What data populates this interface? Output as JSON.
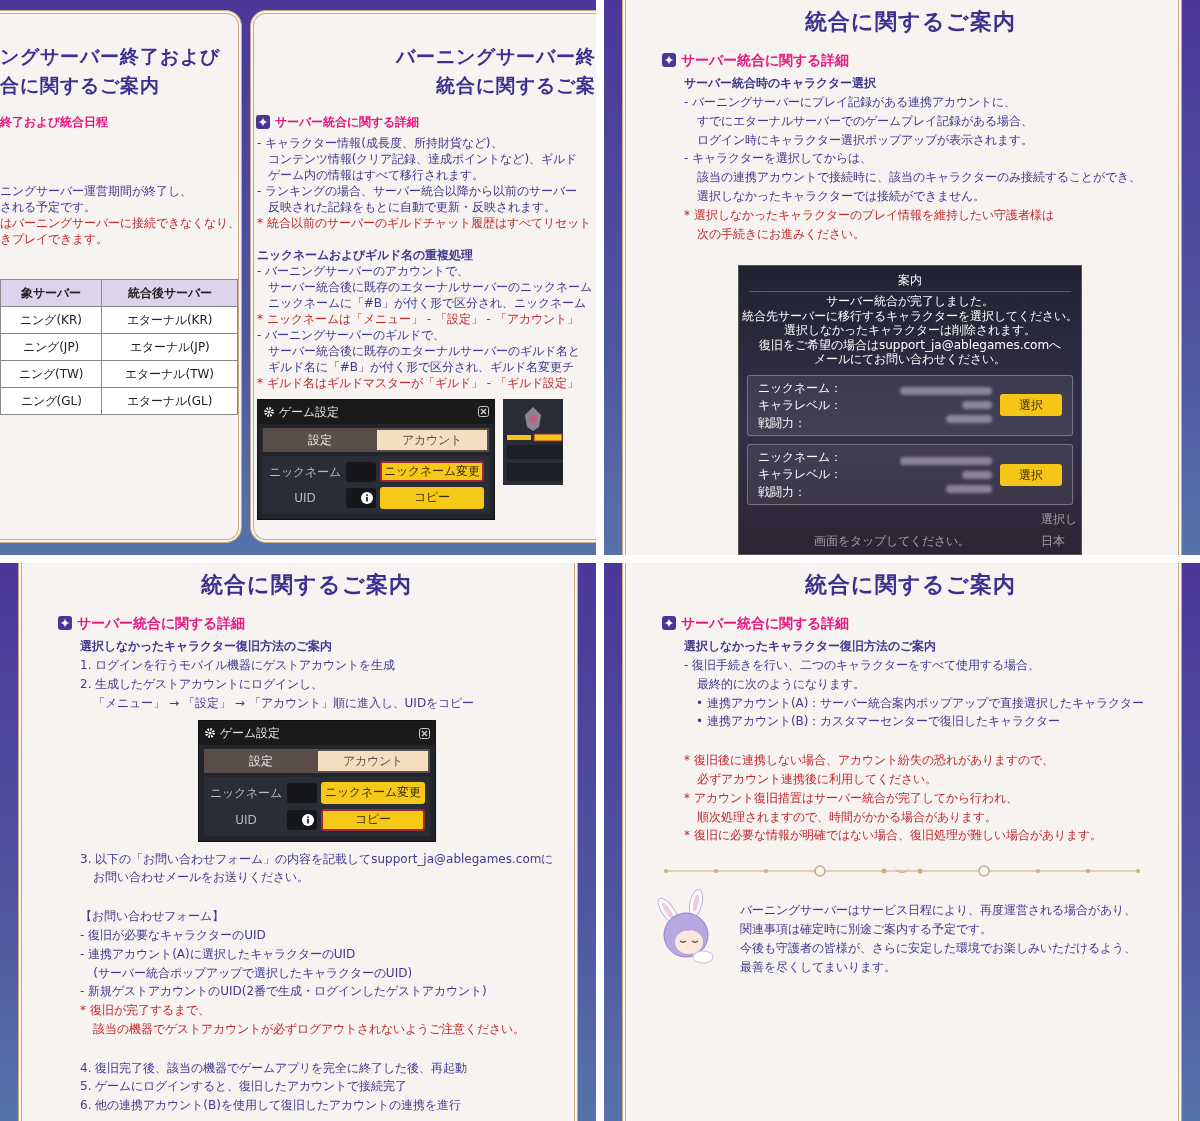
{
  "quadrants": [
    {
      "panels": [
        {
          "title_lines": [
            "ングサーバー終了および",
            "合に関するご案内"
          ],
          "heading_icon": false,
          "heading": "終了および統合日程",
          "blocks": [
            {
              "kind": "spacer"
            },
            {
              "kind": "spacer"
            },
            {
              "kind": "spacer"
            },
            {
              "kind": "text",
              "lines": [
                "ニングサーバー運営期間が終了し、",
                "される予定です。"
              ]
            },
            {
              "kind": "alert",
              "lines": [
                "はバーニングサーバーに接続できなくなり、",
                "きプレイできます。"
              ]
            },
            {
              "kind": "spacer"
            },
            {
              "kind": "spacer"
            },
            {
              "kind": "table",
              "columns": [
                "象サーバー",
                "統合後サーバー"
              ],
              "rows": [
                [
                  "ニング(KR)",
                  "エターナル(KR)"
                ],
                [
                  "ニング(JP)",
                  "エターナル(JP)"
                ],
                [
                  "ニング(TW)",
                  "エターナル(TW)"
                ],
                [
                  "ニング(GL)",
                  "エターナル(GL)"
                ]
              ]
            }
          ]
        },
        {
          "title_lines": [
            "バーニングサーバー終",
            "統合に関するご案"
          ],
          "heading_icon": true,
          "heading": "サーバー統合に関する詳細",
          "blocks": [
            {
              "kind": "item",
              "lines": [
                "- キャラクター情報(成長度、所持財貨など)、",
                "コンテンツ情報(クリア記録、達成ポイントなど)、ギルド",
                "ゲーム内の情報はすべて移行されます。"
              ]
            },
            {
              "kind": "item",
              "lines": [
                "- ランキングの場合、サーバー統合以降から以前のサーバー",
                "反映された記録をもとに自動で更新・反映されます。"
              ]
            },
            {
              "kind": "note",
              "lines": [
                "* 統合以前のサーバーのギルドチャット履歴はすべてリセット"
              ]
            },
            {
              "kind": "spacer"
            },
            {
              "kind": "subhead",
              "lines": [
                "ニックネームおよびギルド名の重複処理"
              ]
            },
            {
              "kind": "item",
              "lines": [
                "- バーニングサーバーのアカウントで、",
                "サーバー統合後に既存のエターナルサーバーのニックネーム",
                "ニックネームに「#B」が付く形で区分され、ニックネーム"
              ]
            },
            {
              "kind": "note",
              "lines": [
                "* ニックネームは「メニュー」 - 「設定」 - 「アカウント」"
              ]
            },
            {
              "kind": "item",
              "lines": [
                "- バーニングサーバーのギルドで、",
                "サーバー統合後に既存のエターナルサーバーのギルド名と",
                "ギルド名に「#B」が付く形で区分され、ギルド名変更チ"
              ]
            },
            {
              "kind": "note",
              "lines": [
                "* ギルド名はギルドマスターが「ギルド」 - 「ギルド設定」"
              ]
            },
            {
              "kind": "shots",
              "items": [
                {
                  "kind": "settings",
                  "title": "ゲーム設定",
                  "tabs": [
                    {
                      "label": "設定",
                      "selected": false
                    },
                    {
                      "label": "アカウント",
                      "selected": true
                    }
                  ],
                  "fields": [
                    {
                      "label": "ニックネーム",
                      "info": false,
                      "button": "ニックネーム変更",
                      "highlighted": true
                    },
                    {
                      "label": "UID",
                      "info": true,
                      "button": "コピー",
                      "highlighted": false
                    }
                  ]
                },
                {
                  "kind": "game_screen"
                }
              ]
            }
          ]
        }
      ]
    },
    {
      "panels": [
        {
          "title_lines": [
            "統合に関するご案内"
          ],
          "heading_icon": true,
          "heading": "サーバー統合に関する詳細",
          "blocks": [
            {
              "kind": "subhead",
              "lines": [
                "サーバー統合時のキャラクター選択"
              ]
            },
            {
              "kind": "item",
              "lines": [
                "- バーニングサーバーにプレイ記録がある連携アカウントに、",
                "すでにエターナルサーバーでのゲームプレイ記録がある場合、",
                "ログイン時にキャラクター選択ポップアップが表示されます。"
              ]
            },
            {
              "kind": "item",
              "lines": [
                "- キャラクターを選択してからは、",
                "該当の連携アカウントで接続時に、該当のキャラクターのみ接続することができ、",
                "選択しなかったキャラクターでは接続ができません。"
              ]
            },
            {
              "kind": "note",
              "lines": [
                "* 選択しなかったキャラクターのプレイ情報を維持したい守護者様は",
                "次の手続きにお進みください。"
              ]
            },
            {
              "kind": "dialog",
              "title": "案内",
              "message": [
                "サーバー統合が完了しました。",
                "統合先サーバーに移行するキャラクターを選択してください。",
                "選択しなかったキャラクターは削除されます。",
                "復旧をご希望の場合はsupport_ja@ablegames.comへ",
                "メールにてお問い合わせください。"
              ],
              "characters": [
                {
                  "labels": [
                    "ニックネーム：",
                    "キャラレベル：",
                    "戦闘力："
                  ],
                  "button": "選択"
                },
                {
                  "labels": [
                    "ニックネーム：",
                    "キャラレベル：",
                    "戦闘力："
                  ],
                  "button": "選択"
                }
              ],
              "hint": "画面をタップしてください。",
              "edge_labels": [
                "選択し",
                "日本"
              ]
            }
          ]
        }
      ]
    },
    {
      "panels": [
        {
          "title_lines": [
            "統合に関するご案内"
          ],
          "heading_icon": true,
          "heading": "サーバー統合に関する詳細",
          "blocks": [
            {
              "kind": "subhead",
              "lines": [
                "選択しなかったキャラクター復旧方法のご案内"
              ]
            },
            {
              "kind": "item",
              "lines": [
                "1. ログインを行うモバイル機器にゲストアカウントを生成"
              ]
            },
            {
              "kind": "item",
              "lines": [
                "2. 生成したゲストアカウントにログインし、",
                "「メニュー」 → 「設定」 → 「アカウント」順に進入し、UIDをコピー"
              ]
            },
            {
              "kind": "shots",
              "items": [
                {
                  "kind": "settings",
                  "title": "ゲーム設定",
                  "tabs": [
                    {
                      "label": "設定",
                      "selected": false
                    },
                    {
                      "label": "アカウント",
                      "selected": true
                    }
                  ],
                  "fields": [
                    {
                      "label": "ニックネーム",
                      "info": false,
                      "button": "ニックネーム変更",
                      "highlighted": false
                    },
                    {
                      "label": "UID",
                      "info": true,
                      "button": "コピー",
                      "highlighted": true
                    }
                  ]
                }
              ]
            },
            {
              "kind": "item",
              "lines": [
                "3. 以下の「お問い合わせフォーム」の内容を記載してsupport_ja@ablegames.comに",
                "お問い合わせメールをお送りください。"
              ]
            },
            {
              "kind": "spacer"
            },
            {
              "kind": "text",
              "lines": [
                "【お問い合わせフォーム】"
              ]
            },
            {
              "kind": "item",
              "lines": [
                "- 復旧が必要なキャラクターのUID"
              ]
            },
            {
              "kind": "item",
              "lines": [
                "- 連携アカウント(A)に選択したキャラクターのUID",
                "(サーバー統合ポップアップで選択したキャラクターのUID)"
              ]
            },
            {
              "kind": "item",
              "lines": [
                "- 新規ゲストアカウントのUID(2番で生成・ログインしたゲストアカウント)"
              ]
            },
            {
              "kind": "note",
              "lines": [
                "* 復旧が完了するまで、",
                "該当の機器でゲストアカウントが必ずログアウトされないようご注意ください。"
              ]
            },
            {
              "kind": "spacer"
            },
            {
              "kind": "item",
              "lines": [
                "4. 復旧完了後、該当の機器でゲームアプリを完全に終了した後、再起動"
              ]
            },
            {
              "kind": "item",
              "lines": [
                "5. ゲームにログインすると、復旧したアカウントで接続完了"
              ]
            },
            {
              "kind": "item",
              "lines": [
                "6. 他の連携アカウント(B)を使用して復旧したアカウントの連携を進行"
              ]
            }
          ]
        }
      ]
    },
    {
      "panels": [
        {
          "title_lines": [
            "統合に関するご案内"
          ],
          "heading_icon": true,
          "heading": "サーバー統合に関する詳細",
          "blocks": [
            {
              "kind": "subhead",
              "lines": [
                "選択しなかったキャラクター復旧方法のご案内"
              ]
            },
            {
              "kind": "item",
              "lines": [
                "- 復旧手続きを行い、二つのキャラクターをすべて使用する場合、",
                "最終的に次のようになります。"
              ]
            },
            {
              "kind": "bullet",
              "lines": [
                "• 連携アカウント(A)：サーバー統合案内ポップアップで直接選択したキャラクター"
              ]
            },
            {
              "kind": "bullet",
              "lines": [
                "• 連携アカウント(B)：カスタマーセンターで復旧したキャラクター"
              ]
            },
            {
              "kind": "spacer"
            },
            {
              "kind": "note",
              "lines": [
                "* 復旧後に連携しない場合、アカウント紛失の恐れがありますので、",
                "必ずアカウント連携後に利用してください。"
              ]
            },
            {
              "kind": "note",
              "lines": [
                "* アカウント復旧措置はサーバー統合が完了してから行われ、",
                "順次処理されますので、時間がかかる場合があります。"
              ]
            },
            {
              "kind": "note",
              "lines": [
                "* 復旧に必要な情報が明確ではない場合、復旧処理が難しい場合があります。"
              ]
            },
            {
              "kind": "divider"
            },
            {
              "kind": "closing",
              "lines": [
                "バーニングサーバーはサービス日程により、再度運営される場合があり、",
                "関連事項は確定時に別途ご案内する予定です。",
                "今後も守護者の皆様が、さらに安定した環境でお楽しみいただけるよう、",
                "最善を尽くしてまいります。"
              ]
            }
          ]
        }
      ]
    }
  ]
}
